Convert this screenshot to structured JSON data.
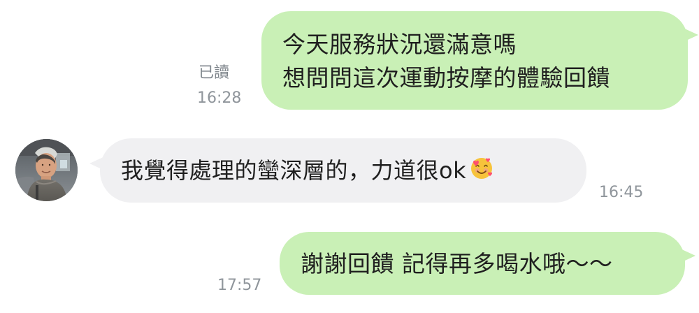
{
  "messages": [
    {
      "lines": [
        "今天服務狀況還滿意嗎",
        "想問問這次運動按摩的體驗回饋"
      ],
      "read_status": "已讀",
      "time": "16:28"
    },
    {
      "text": "我覺得處理的蠻深層的，力道很ok",
      "emoji": "smiling-face-with-hearts-icon",
      "time": "16:45"
    },
    {
      "text": "謝謝回饋 記得再多喝水哦～～",
      "time": "17:57"
    }
  ],
  "colors": {
    "outgoing_bubble": "#c9f0b6",
    "incoming_bubble": "#f0f0f2",
    "meta_text": "#8f959b"
  }
}
